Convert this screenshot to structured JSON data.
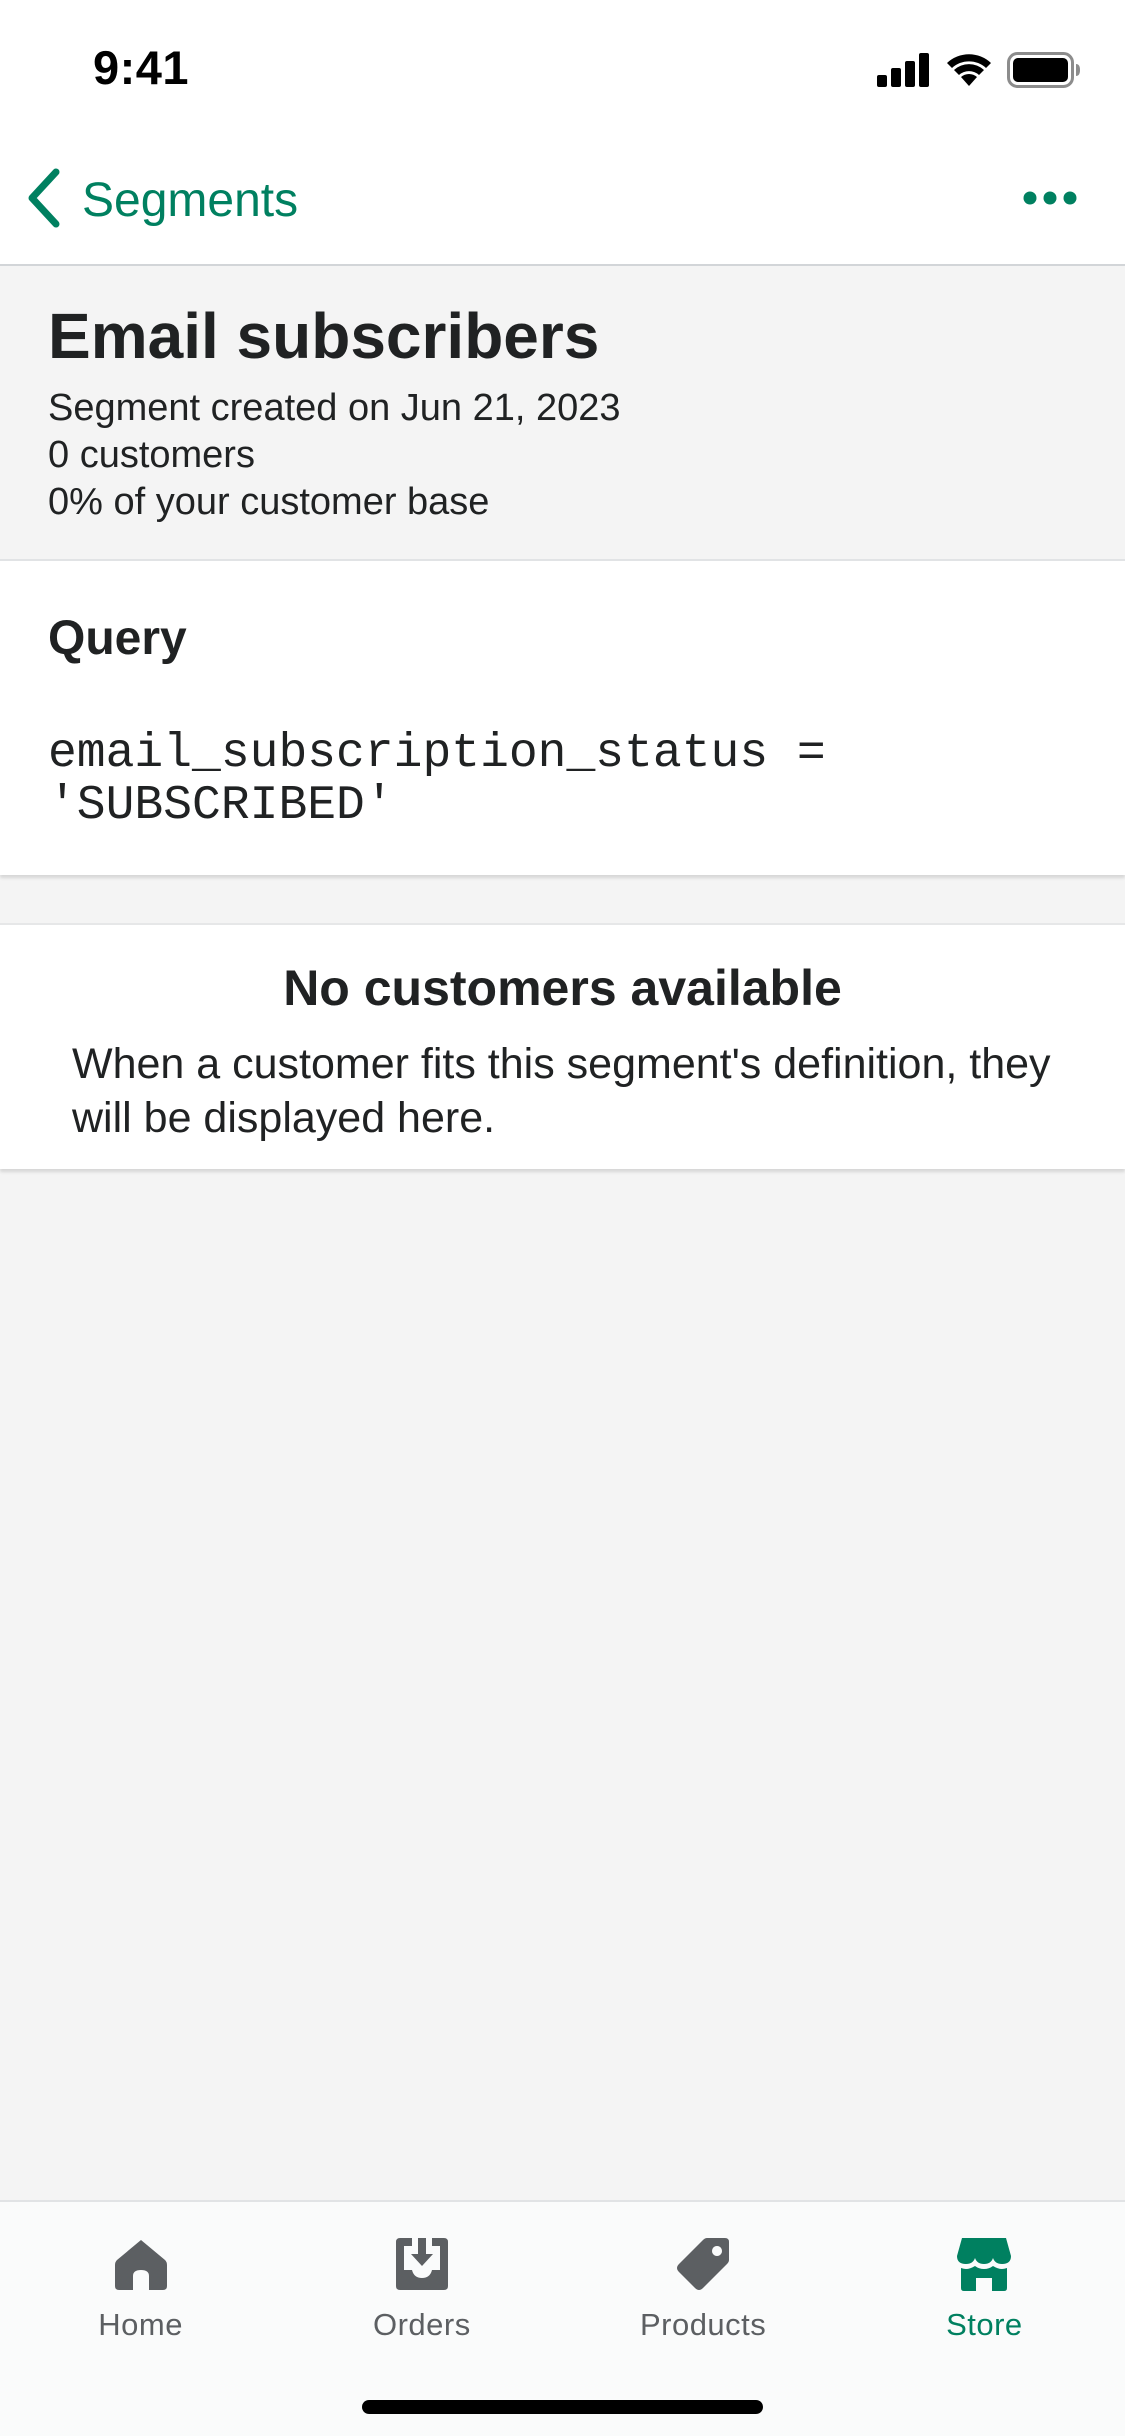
{
  "status_bar": {
    "time": "9:41"
  },
  "nav": {
    "back_label": "Segments",
    "back_icon": "chevron-left-icon",
    "more_icon": "ellipsis-horizontal-icon"
  },
  "segment": {
    "title": "Email subscribers",
    "created": "Segment created on Jun 21, 2023",
    "customers": "0 customers",
    "base_share": "0% of your customer base"
  },
  "query": {
    "heading": "Query",
    "code": "email_subscription_status = 'SUBSCRIBED'"
  },
  "empty_state": {
    "title": "No customers available",
    "description": "When a customer fits this segment's definition, they will be displayed here."
  },
  "tab_bar": {
    "items": [
      {
        "label": "Home",
        "icon": "home-icon",
        "active": false
      },
      {
        "label": "Orders",
        "icon": "orders-icon",
        "active": false
      },
      {
        "label": "Products",
        "icon": "tag-icon",
        "active": false
      },
      {
        "label": "Store",
        "icon": "store-icon",
        "active": true
      }
    ]
  },
  "colors": {
    "accent": "#008060",
    "tab_inactive": "#5c5f62",
    "text": "#202223",
    "background": "#f4f4f4"
  }
}
